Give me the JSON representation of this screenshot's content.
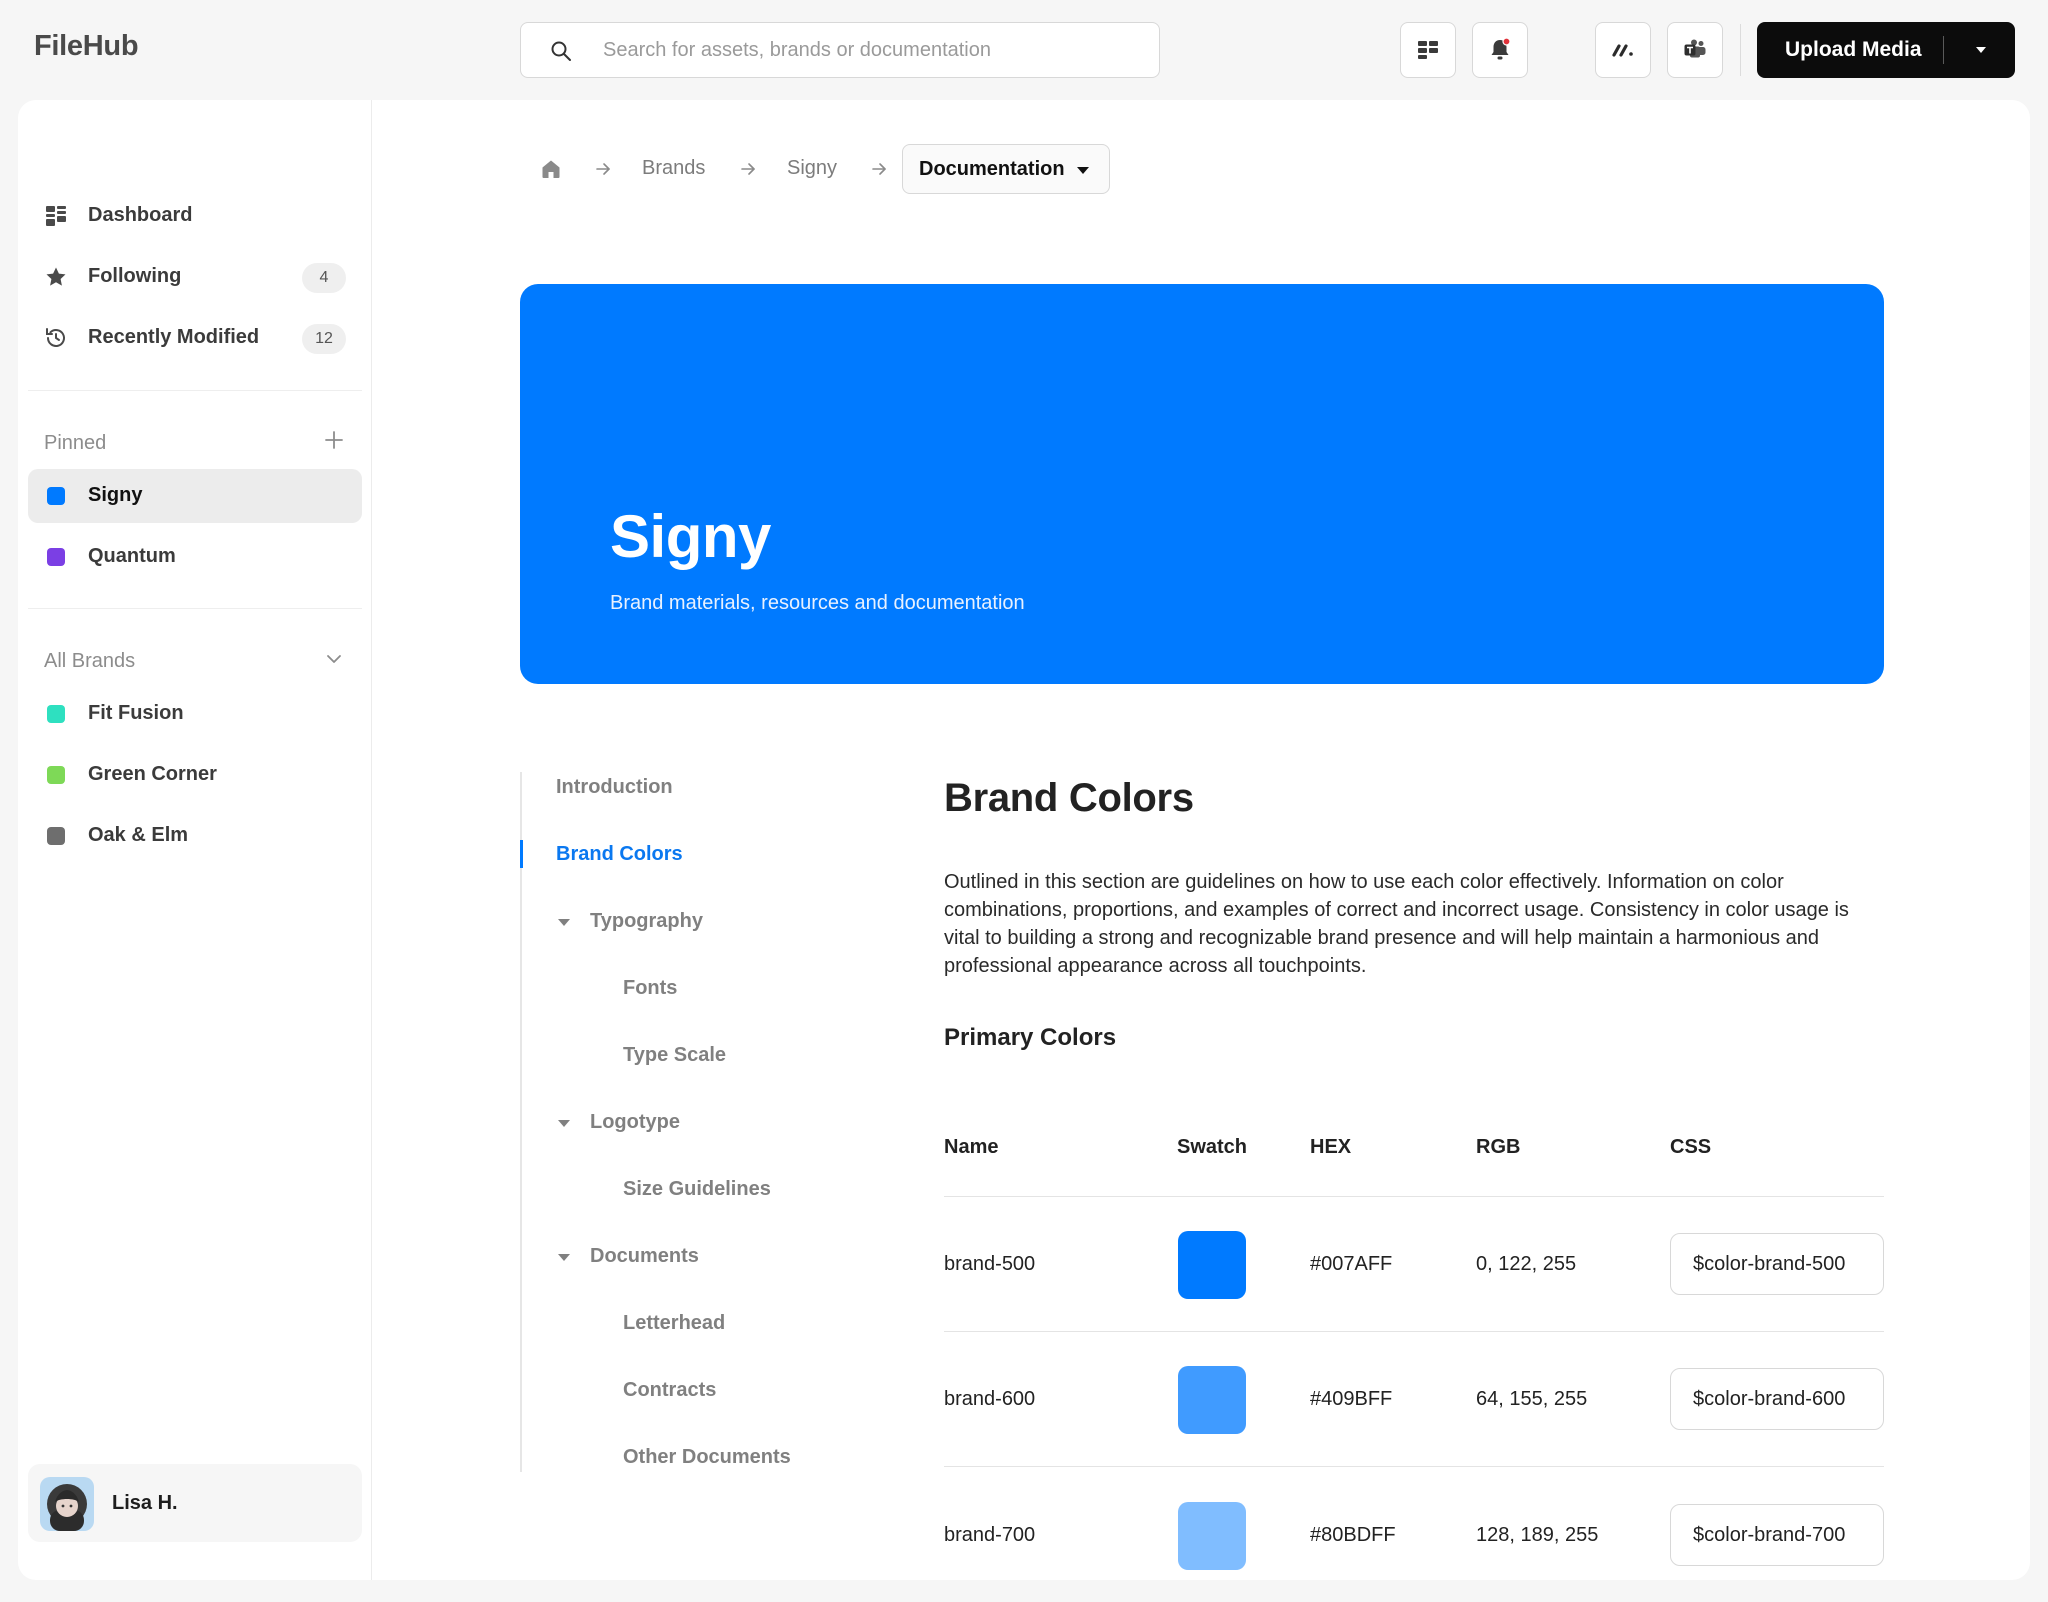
{
  "app": {
    "name": "FileHub"
  },
  "search": {
    "placeholder": "Search for assets, brands or documentation"
  },
  "toolbar": {
    "upload_label": "Upload Media"
  },
  "sidebar": {
    "nav": [
      {
        "label": "Dashboard",
        "icon": "dashboard-icon"
      },
      {
        "label": "Following",
        "icon": "star-icon",
        "badge": "4"
      },
      {
        "label": "Recently Modified",
        "icon": "history-icon",
        "badge": "12"
      }
    ],
    "pinned_title": "Pinned",
    "pinned": [
      {
        "label": "Signy",
        "color": "#007AFF",
        "active": true
      },
      {
        "label": "Quantum",
        "color": "#7B3FE4"
      }
    ],
    "brands_title": "All Brands",
    "brands": [
      {
        "label": "Fit Fusion",
        "color": "#2EE0C0"
      },
      {
        "label": "Green Corner",
        "color": "#7ED957"
      },
      {
        "label": "Oak & Elm",
        "color": "#6E6E6E"
      }
    ],
    "user": {
      "name": "Lisa H."
    }
  },
  "breadcrumb": {
    "items": [
      "Brands",
      "Signy"
    ],
    "current": "Documentation"
  },
  "hero": {
    "title": "Signy",
    "subtitle": "Brand materials, resources and documentation",
    "color": "#007AFF"
  },
  "toc": {
    "items": [
      {
        "label": "Introduction"
      },
      {
        "label": "Brand Colors",
        "active": true
      },
      {
        "label": "Typography",
        "expandable": true
      },
      {
        "label": "Fonts",
        "child": true
      },
      {
        "label": "Type Scale",
        "child": true
      },
      {
        "label": "Logotype",
        "expandable": true
      },
      {
        "label": "Size Guidelines",
        "child": true
      },
      {
        "label": "Documents",
        "expandable": true
      },
      {
        "label": "Letterhead",
        "child": true
      },
      {
        "label": "Contracts",
        "child": true
      },
      {
        "label": "Other Documents",
        "child": true
      }
    ]
  },
  "doc": {
    "title": "Brand Colors",
    "intro": "Outlined in this section are guidelines on how to use each color effectively. Information on color combinations, proportions, and examples of correct and incorrect usage. Consistency in color usage is vital to building a strong and recognizable brand presence and will help maintain a harmonious and professional appearance across all touchpoints.",
    "section_title": "Primary Colors",
    "table": {
      "headers": [
        "Name",
        "Swatch",
        "HEX",
        "RGB",
        "CSS"
      ],
      "rows": [
        {
          "name": "brand-500",
          "hex": "#007AFF",
          "rgb": "0, 122, 255",
          "css": "$color-brand-500"
        },
        {
          "name": "brand-600",
          "hex": "#409BFF",
          "rgb": "64, 155, 255",
          "css": "$color-brand-600"
        },
        {
          "name": "brand-700",
          "hex": "#80BDFF",
          "rgb": "128, 189, 255",
          "css": "$color-brand-700"
        }
      ]
    }
  }
}
